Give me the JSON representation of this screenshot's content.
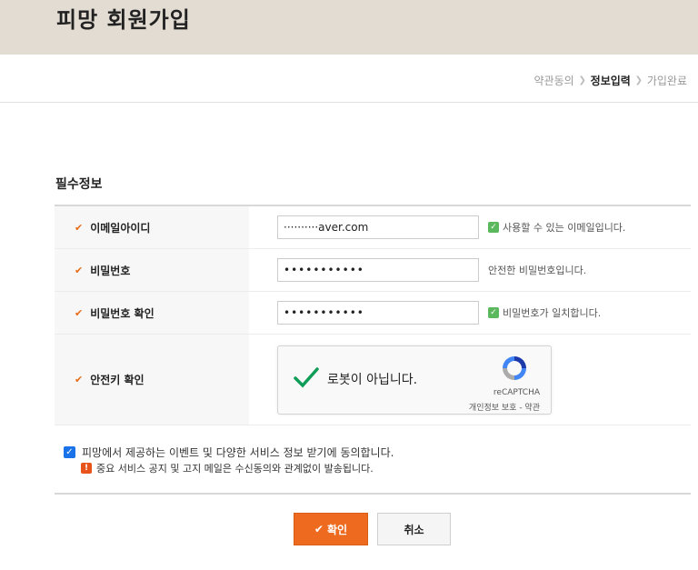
{
  "header": {
    "title": "피망 회원가입"
  },
  "steps": [
    {
      "label": "약관동의",
      "active": false
    },
    {
      "label": "정보입력",
      "active": true
    },
    {
      "label": "가입완료",
      "active": false
    }
  ],
  "section": {
    "title": "필수정보"
  },
  "fields": {
    "email": {
      "label": "이메일아이디",
      "value": "··········aver.com",
      "hint": "사용할 수 있는 이메일입니다."
    },
    "password": {
      "label": "비밀번호",
      "value": "•••••••••••",
      "hint": "안전한 비밀번호입니다."
    },
    "password_confirm": {
      "label": "비밀번호 확인",
      "value": "•••••••••••",
      "hint": "비밀번호가 일치합니다."
    },
    "safety_key": {
      "label": "안전키 확인"
    }
  },
  "recaptcha": {
    "label": "로봇이 아닙니다.",
    "brand": "reCAPTCHA",
    "links": "개인정보 보호 - 약관"
  },
  "agree": {
    "label": "피망에서 제공하는 이벤트 및 다양한 서비스 정보 받기에 동의합니다.",
    "checked": true,
    "notice": "중요 서비스 공지 및 고지 메일은 수신동의와 관계없이 발송됩니다."
  },
  "buttons": {
    "confirm": "확인",
    "cancel": "취소"
  },
  "colors": {
    "accent": "#ed6a1e",
    "header_bg": "#e2dcd3",
    "success": "#5cb85c"
  }
}
